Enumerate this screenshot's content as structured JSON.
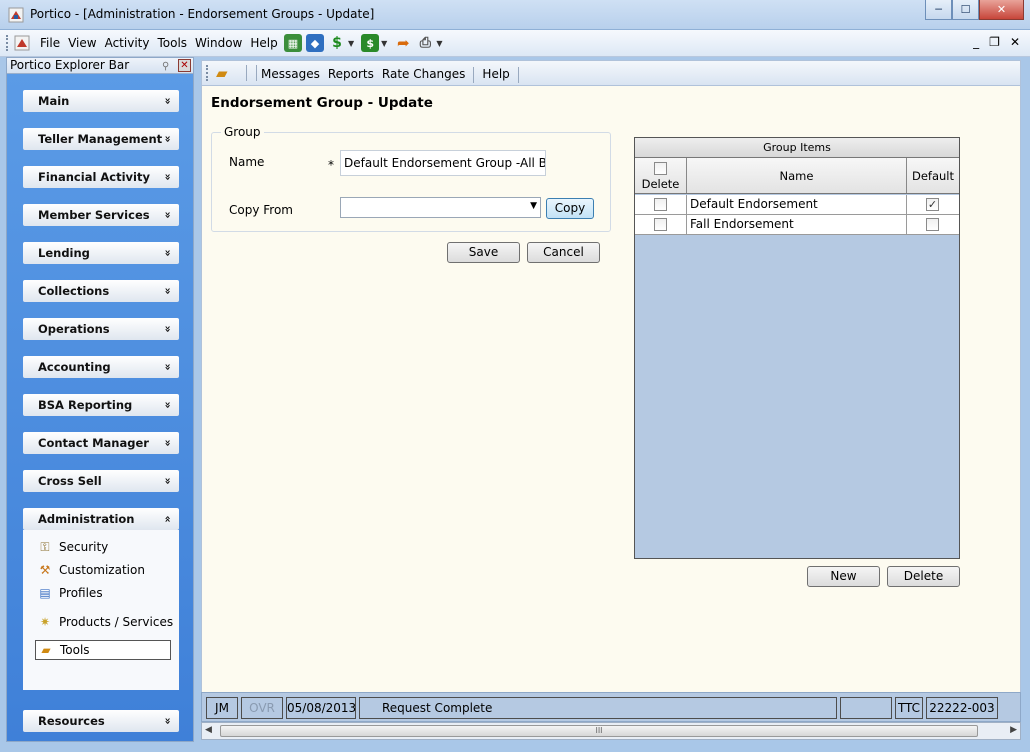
{
  "window": {
    "title": "Portico - [Administration - Endorsement Groups - Update]",
    "minimize": "─",
    "maximize": "☐",
    "close": "✕"
  },
  "menu": {
    "items": [
      {
        "label": "File"
      },
      {
        "label": "View"
      },
      {
        "label": "Activity"
      },
      {
        "label": "Tools"
      },
      {
        "label": "Window"
      },
      {
        "label": "Help"
      }
    ],
    "mdi_minimize": "_",
    "mdi_restore": "❐",
    "mdi_close": "✕"
  },
  "explorer": {
    "title": "Portico Explorer Bar",
    "groups": [
      {
        "label": "Main"
      },
      {
        "label": "Teller Management"
      },
      {
        "label": "Financial Activity"
      },
      {
        "label": "Member Services"
      },
      {
        "label": "Lending"
      },
      {
        "label": "Collections"
      },
      {
        "label": "Operations"
      },
      {
        "label": "Accounting"
      },
      {
        "label": "BSA Reporting"
      },
      {
        "label": "Contact Manager"
      },
      {
        "label": "Cross Sell"
      },
      {
        "label": "Administration"
      },
      {
        "label": "Resources"
      }
    ],
    "collapse_glyph": "»",
    "expand_glyph": "«",
    "admin_items": [
      {
        "label": "Security",
        "icon": "security-icon"
      },
      {
        "label": "Customization",
        "icon": "customization-icon"
      },
      {
        "label": "Profiles",
        "icon": "profiles-icon"
      },
      {
        "label": "Products / Services",
        "icon": "products-icon"
      },
      {
        "label": "Tools",
        "icon": "tools-icon",
        "selected": true
      }
    ]
  },
  "toolbar": {
    "items": [
      {
        "label": "Messages"
      },
      {
        "label": "Reports"
      },
      {
        "label": "Rate Changes"
      },
      {
        "label": "Help"
      }
    ]
  },
  "page": {
    "title": "Endorsement Group - Update",
    "group_legend": "Group",
    "name_label": "Name",
    "required_mark": "*",
    "name_value": "Default Endorsement Group -All Bran",
    "copy_from_label": "Copy From",
    "copy_from_value": "",
    "copy_button": "Copy",
    "save_button": "Save",
    "cancel_button": "Cancel"
  },
  "grid": {
    "caption": "Group Items",
    "columns": {
      "delete": "Delete",
      "name": "Name",
      "default": "Default"
    },
    "rows": [
      {
        "name": "Default Endorsement",
        "delete": false,
        "default": true
      },
      {
        "name": "Fall Endorsement",
        "delete": false,
        "default": false
      }
    ],
    "new_button": "New",
    "delete_button": "Delete"
  },
  "status": {
    "user": "JM",
    "ovr": "OVR",
    "date": "05/08/2013",
    "message": "Request Complete",
    "empty": "",
    "ttc": "TTC",
    "id": "22222-003"
  },
  "scrollbar_grip": "III",
  "check_glyph": "✓"
}
